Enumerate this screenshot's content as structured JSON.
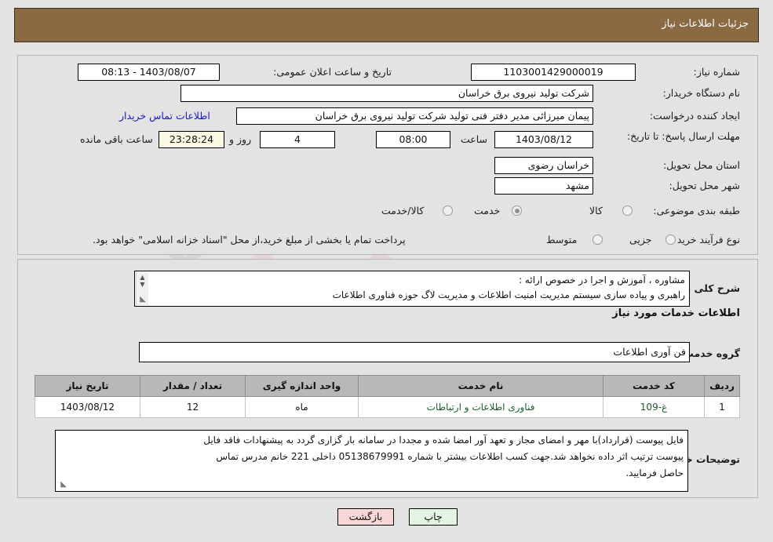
{
  "header": {
    "title": "جزئیات اطلاعات نیاز"
  },
  "watermark": {
    "text": "AriaTender.net"
  },
  "top": {
    "need_number_label": "شماره نیاز:",
    "need_number_value": "1103001429000019",
    "announce_label": "تاریخ و ساعت اعلان عمومی:",
    "announce_value": "1403/08/07 - 08:13",
    "buyer_org_label": "نام دستگاه خریدار:",
    "buyer_org_value": "شرکت تولید نیروی برق خراسان",
    "creator_label": "ایجاد کننده درخواست:",
    "creator_value": "پیمان میرزائی مدیر دفتر فنی تولید شرکت تولید نیروی برق خراسان",
    "contact_link": "اطلاعات تماس خریدار",
    "deadline_label": "مهلت ارسال پاسخ: تا تاریخ:",
    "deadline_date": "1403/08/12",
    "deadline_hour_label": "ساعت",
    "deadline_hour": "08:00",
    "remaining_days": "4",
    "days_and_label": "روز و",
    "remaining_time": "23:28:24",
    "remaining_suffix": "ساعت باقی مانده",
    "province_label": "استان محل تحویل:",
    "province_value": "خراسان رضوی",
    "city_label": "شهر محل تحویل:",
    "city_value": "مشهد",
    "category_label": "طبقه بندی موضوعی:",
    "category_options": [
      {
        "label": "کالا",
        "selected": false
      },
      {
        "label": "خدمت",
        "selected": true
      },
      {
        "label": "کالا/خدمت",
        "selected": false
      }
    ],
    "process_label": "نوع فرآیند خرید :",
    "process_options": [
      {
        "label": "جزیی",
        "selected": false
      },
      {
        "label": "متوسط",
        "selected": false
      }
    ],
    "treasury_note": "پرداخت تمام یا بخشی از مبلغ خرید،از محل \"اسناد خزانه اسلامی\" خواهد بود."
  },
  "bottom": {
    "summary_label": "شرح کلی نیاز:",
    "summary_text_line1": "مشاوره ، آموزش و اجرا در خصوص ارائه :",
    "summary_text_line2": "راهبری و پیاده سازی سیستم مدیریت امنیت اطلاعات و مدیریت لاگ حوزه فناوری اطلاعات",
    "section_title": "اطلاعات خدمات مورد نیاز",
    "service_group_label": "گروه خدمت:",
    "service_group_value": "فن آوری اطلاعات",
    "table": {
      "columns": [
        "ردیف",
        "کد خدمت",
        "نام خدمت",
        "واحد اندازه گیری",
        "تعداد / مقدار",
        "تاریخ نیاز"
      ],
      "rows": [
        {
          "row": "1",
          "code": "غ-109",
          "name": "فناوری اطلاعات و ارتباطات",
          "unit": "ماه",
          "qty": "12",
          "date": "1403/08/12"
        }
      ]
    },
    "buyer_notes_label": "توضیحات خریدار:",
    "buyer_notes_line1": "فایل پیوست (قرارداد)با مهر و امضای مجاز و تعهد آور امضا شده و مجددا در سامانه بار گزاری گردد به پیشنهادات فاقد فایل",
    "buyer_notes_line2": "پیوست ترتیب اثر داده نخواهد شد.جهت کسب اطلاعات بیشتر با شماره 05138679991 داخلی 221 خانم مدرس تماس",
    "buyer_notes_line3": "حاصل فرمایید."
  },
  "buttons": {
    "print": "چاپ",
    "back": "بازگشت"
  }
}
